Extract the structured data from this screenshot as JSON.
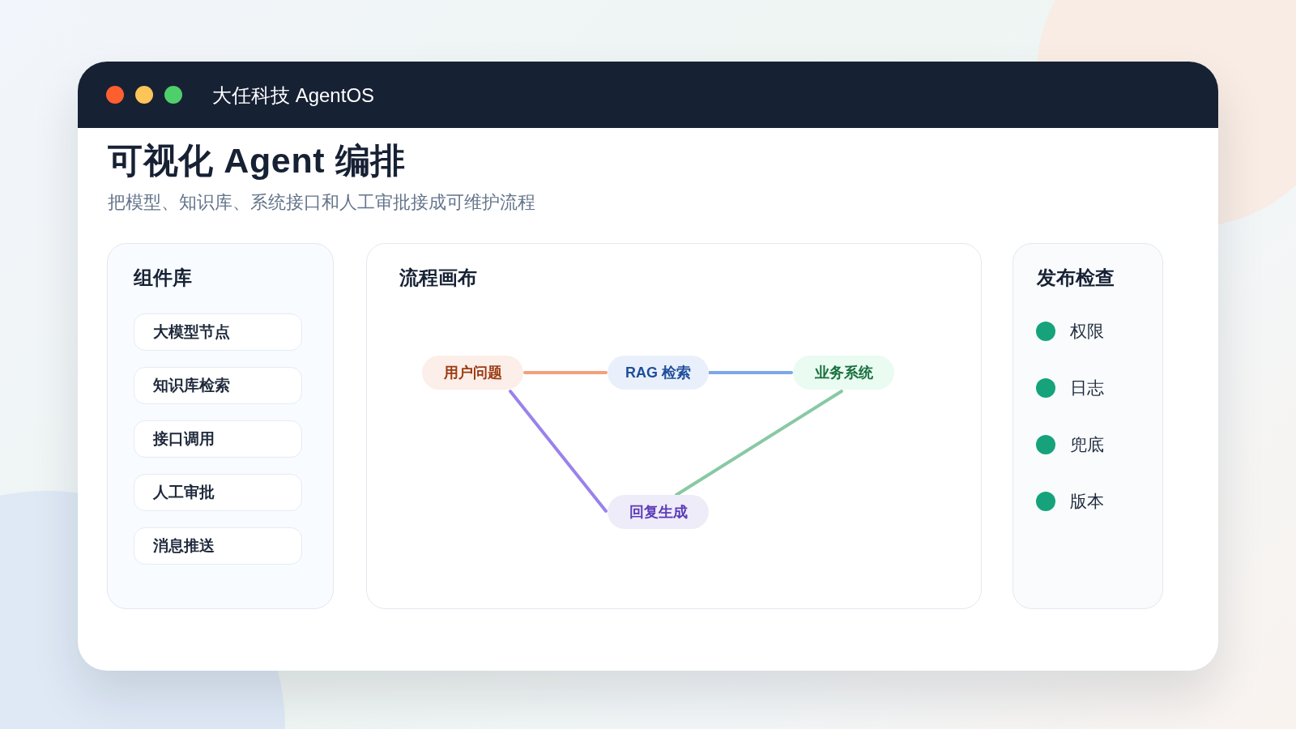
{
  "window": {
    "title": "大任科技 AgentOS",
    "controls": [
      {
        "color": "#fe5f2f"
      },
      {
        "color": "#fdc458"
      },
      {
        "color": "#4fcf6a"
      }
    ]
  },
  "page": {
    "heading": "可视化 Agent 编排",
    "subtitle": "把模型、知识库、系统接口和人工审批接成可维护流程"
  },
  "component_library": {
    "title": "组件库",
    "items": [
      {
        "label": "大模型节点"
      },
      {
        "label": "知识库检索"
      },
      {
        "label": "接口调用"
      },
      {
        "label": "人工审批"
      },
      {
        "label": "消息推送"
      }
    ]
  },
  "flow_canvas": {
    "title": "流程画布",
    "nodes": [
      {
        "label": "用户问题",
        "color": "#9a3b12"
      },
      {
        "label": "RAG 检索",
        "color": "#1e4e9c"
      },
      {
        "label": "业务系统",
        "color": "#17703f"
      },
      {
        "label": "回复生成",
        "color": "#5b3ab8"
      }
    ],
    "edges": [
      {
        "color": "#f2a07a"
      },
      {
        "color": "#7ea7ea"
      },
      {
        "color": "#9a82ec"
      },
      {
        "color": "#88c9a4"
      }
    ]
  },
  "release_checks": {
    "title": "发布检查",
    "items": [
      {
        "label": "权限",
        "passed": true
      },
      {
        "label": "日志",
        "passed": true
      },
      {
        "label": "兜底",
        "passed": true
      },
      {
        "label": "版本",
        "passed": true
      }
    ]
  }
}
